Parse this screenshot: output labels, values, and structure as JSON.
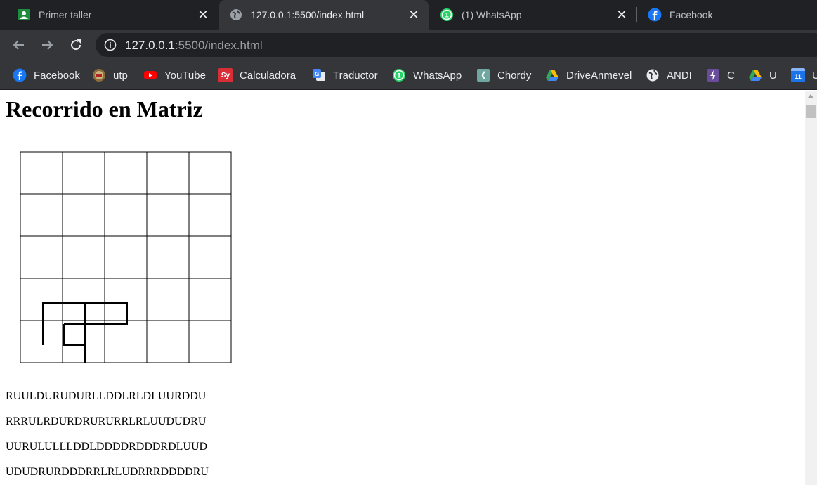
{
  "browser": {
    "tabs": [
      {
        "title": "Primer taller",
        "icon": "classroom-icon",
        "active": false
      },
      {
        "title": "127.0.0.1:5500/index.html",
        "icon": "globe-icon",
        "active": true
      },
      {
        "title": "(1) WhatsApp",
        "icon": "whatsapp-icon",
        "active": false
      },
      {
        "title": "Facebook",
        "icon": "facebook-icon",
        "active": false
      }
    ],
    "address": {
      "host": "127.0.0.1",
      "rest": ":5500/index.html"
    },
    "bookmarks": [
      {
        "label": "Facebook",
        "icon": "facebook-icon"
      },
      {
        "label": "utp",
        "icon": "utp-icon"
      },
      {
        "label": "YouTube",
        "icon": "youtube-icon"
      },
      {
        "label": "Calculadora",
        "icon": "symbolab-icon",
        "icon_text": "Sy"
      },
      {
        "label": "Traductor",
        "icon": "google-translate-icon"
      },
      {
        "label": "WhatsApp",
        "icon": "whatsapp-icon"
      },
      {
        "label": "Chordy",
        "icon": "chordy-icon"
      },
      {
        "label": "DriveAnmevel",
        "icon": "google-drive-icon"
      },
      {
        "label": "ANDI",
        "icon": "globe-icon"
      },
      {
        "label": "C",
        "icon": "bolt-icon"
      },
      {
        "label": "U",
        "icon": "google-drive-icon"
      },
      {
        "label": "U",
        "icon": "google-calendar-icon",
        "icon_text": "11"
      }
    ],
    "colors": {
      "tabstrip": "#202124",
      "toolbar": "#35363a",
      "text": "#e8eaed"
    }
  },
  "page": {
    "title": "Recorrido en Matriz",
    "matrix": {
      "rows": 5,
      "cols": 5,
      "path_moves": [
        [
          "U",
          "U",
          "R",
          "R",
          "R",
          "R",
          "D",
          "L",
          "L",
          "D",
          "L",
          "U"
        ],
        [
          "R",
          "U",
          "D",
          "D",
          "D",
          "D",
          "L",
          "L",
          "L",
          "D"
        ],
        [
          "R",
          "U",
          "R",
          "R",
          "R",
          "D",
          "L",
          "L"
        ]
      ]
    },
    "sequences": [
      "RUULDURUDURLLDDLRLDLUURDDU",
      "RRRULRDURDRURURRLRLUUDUDRU",
      "UURULULLLDDLDDDDRDDDRDLUUD",
      "UDUDRURDDDRRLRLUDRRRDDDDRU"
    ]
  }
}
